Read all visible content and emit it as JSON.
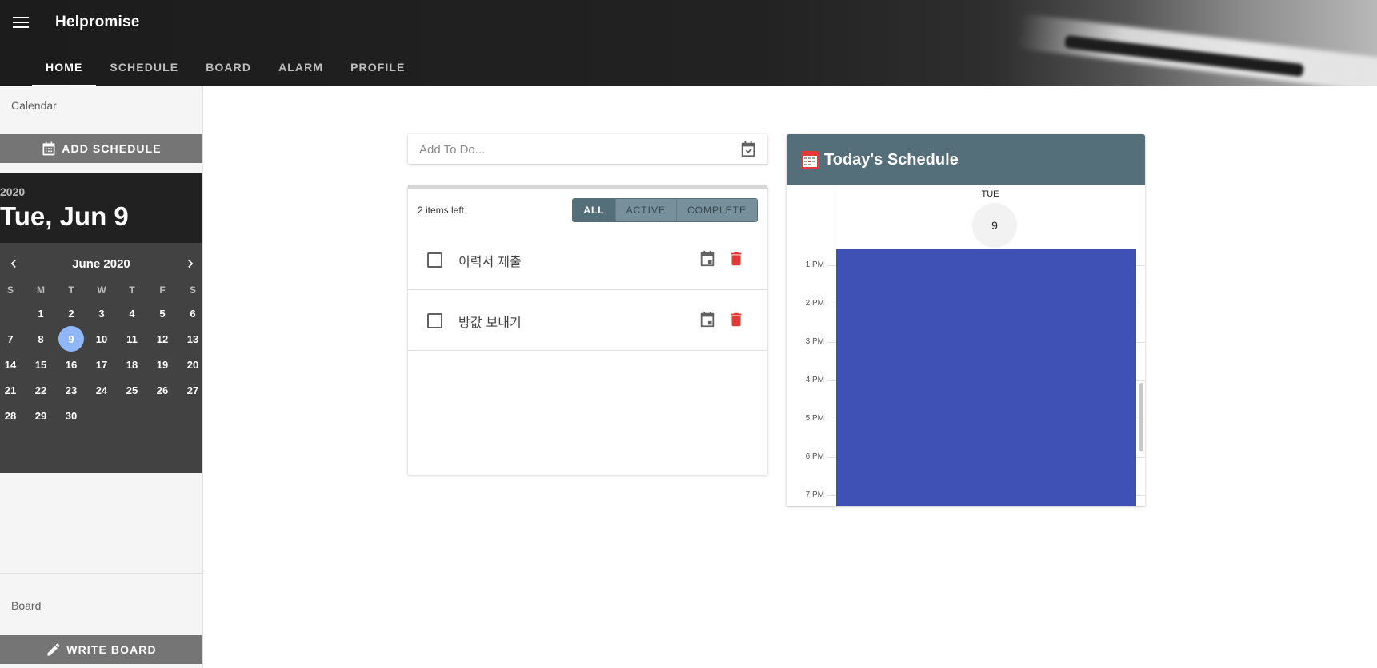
{
  "app": {
    "title": "Helpromise",
    "tabs": [
      {
        "label": "HOME",
        "active": true
      },
      {
        "label": "SCHEDULE",
        "active": false
      },
      {
        "label": "BOARD",
        "active": false
      },
      {
        "label": "ALARM",
        "active": false
      },
      {
        "label": "PROFILE",
        "active": false
      }
    ]
  },
  "sidebar": {
    "calendar_label": "Calendar",
    "add_schedule_label": "ADD SCHEDULE",
    "picker": {
      "year": "2020",
      "selected_date": "Tue, Jun 9",
      "month_label": "June 2020",
      "weekdays": [
        "S",
        "M",
        "T",
        "W",
        "T",
        "F",
        "S"
      ],
      "first_weekday_offset": 1,
      "days": [
        "1",
        "2",
        "3",
        "4",
        "5",
        "6",
        "7",
        "8",
        "9",
        "10",
        "11",
        "12",
        "13",
        "14",
        "15",
        "16",
        "17",
        "18",
        "19",
        "20",
        "21",
        "22",
        "23",
        "24",
        "25",
        "26",
        "27",
        "28",
        "29",
        "30"
      ],
      "selected_day": "9"
    },
    "board_label": "Board",
    "write_board_label": "WRITE BOARD"
  },
  "todo": {
    "input_placeholder": "Add To Do...",
    "items_left": "2 items left",
    "filters": [
      {
        "label": "ALL",
        "active": true
      },
      {
        "label": "ACTIVE",
        "active": false
      },
      {
        "label": "COMPLETE",
        "active": false
      }
    ],
    "items": [
      {
        "text": "이력서 제출",
        "done": false
      },
      {
        "text": "방값 보내기",
        "done": false
      }
    ]
  },
  "schedule": {
    "title": "Today's Schedule",
    "day_of_week": "TUE",
    "day_number": "9",
    "hours": [
      "1 PM",
      "2 PM",
      "3 PM",
      "4 PM",
      "5 PM",
      "6 PM",
      "7 PM"
    ]
  },
  "colors": {
    "accent": "#546e7a",
    "event": "#3f51b5",
    "selected_day": "#90b8f8",
    "delete": "#e53935"
  }
}
